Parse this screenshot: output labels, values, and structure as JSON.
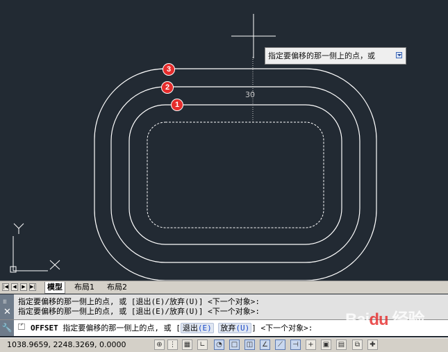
{
  "tooltip": {
    "text": "指定要偏移的那一侧上的点，或"
  },
  "dimension": {
    "value": "30"
  },
  "badges": [
    "3",
    "2",
    "1"
  ],
  "icons": {
    "crosshair": "crosshair-cursor-icon",
    "ucs": "ucs-axis-icon",
    "tooltip_dropdown": "dropdown-arrow-icon"
  },
  "ucs": {
    "y": "Y",
    "x": "X"
  },
  "tabs": {
    "nav": [
      "|◀",
      "◀",
      "▶",
      "▶|"
    ],
    "items": [
      "模型",
      "布局1",
      "布局2"
    ]
  },
  "command": {
    "history": [
      "指定要偏移的那一侧上的点, 或 [退出(E)/放弃(U)] <下一个对象>:",
      "指定要偏移的那一侧上的点, 或 [退出(E)/放弃(U)] <下一个对象>:"
    ],
    "keyword": "OFFSET",
    "prompt": "指定要偏移的那一侧上的点, 或 [",
    "opt1_label": "退出",
    "opt1_key": "(E)",
    "opt2_label": "放弃",
    "opt2_key": "(U)",
    "suffix": "] <下一个对象>:"
  },
  "status": {
    "coords": "1038.9659, 2248.3269, 0.0000"
  },
  "watermark": {
    "brand": "Bai",
    "paw": "du",
    "cn": "经验"
  },
  "colors": {
    "canvas": "#222a33",
    "badge": "#e52c2c",
    "lines": "#ffffff"
  }
}
